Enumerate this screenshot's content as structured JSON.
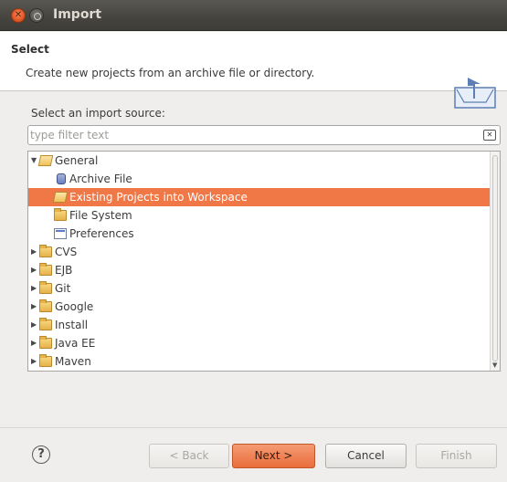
{
  "window": {
    "title": "Import"
  },
  "header": {
    "title": "Select",
    "description": "Create new projects from an archive file or directory."
  },
  "source": {
    "label": "Select an import source:",
    "filter_placeholder": "type filter text"
  },
  "tree": {
    "items": [
      {
        "label": "General",
        "icon": "folder-open-icon",
        "expanded": true,
        "level": 0
      },
      {
        "label": "Archive File",
        "icon": "archive-icon",
        "level": 1
      },
      {
        "label": "Existing Projects into Workspace",
        "icon": "project-folder-icon",
        "level": 1,
        "selected": true
      },
      {
        "label": "File System",
        "icon": "folder-icon",
        "level": 1
      },
      {
        "label": "Preferences",
        "icon": "preferences-icon",
        "level": 1
      },
      {
        "label": "CVS",
        "icon": "folder-icon",
        "level": 0
      },
      {
        "label": "EJB",
        "icon": "folder-icon",
        "level": 0
      },
      {
        "label": "Git",
        "icon": "folder-icon",
        "level": 0
      },
      {
        "label": "Google",
        "icon": "folder-icon",
        "level": 0
      },
      {
        "label": "Install",
        "icon": "folder-icon",
        "level": 0
      },
      {
        "label": "Java EE",
        "icon": "folder-icon",
        "level": 0
      },
      {
        "label": "Maven",
        "icon": "folder-icon",
        "level": 0
      }
    ]
  },
  "buttons": {
    "help": "?",
    "back": "< Back",
    "next": "Next >",
    "cancel": "Cancel",
    "finish": "Finish"
  },
  "colors": {
    "selection": "#f07746",
    "titlebar": "#45443f",
    "accent_button": "#ea6d3b"
  }
}
